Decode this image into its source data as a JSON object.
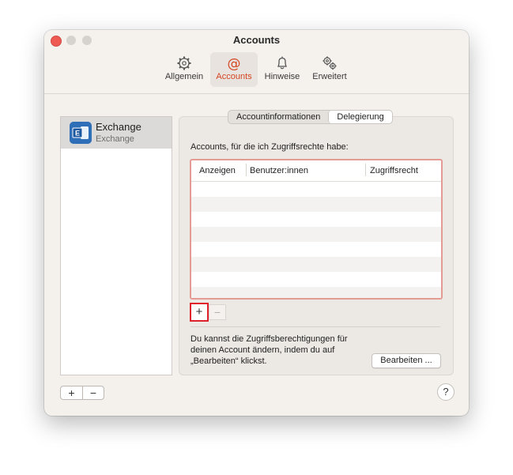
{
  "window": {
    "title": "Accounts"
  },
  "toolbar": {
    "tabs": [
      {
        "label": "Allgemein",
        "icon": "gear-icon"
      },
      {
        "label": "Accounts",
        "icon": "at-sign-icon",
        "selected": true
      },
      {
        "label": "Hinweise",
        "icon": "bell-icon"
      },
      {
        "label": "Erweitert",
        "icon": "gears-icon"
      }
    ]
  },
  "sidebar": {
    "accounts": [
      {
        "name": "Exchange",
        "type": "Exchange",
        "icon": "exchange-icon"
      }
    ],
    "add_label": "+",
    "remove_label": "−"
  },
  "segments": {
    "info": "Accountinformationen",
    "delegation": "Delegierung",
    "selected": "Delegierung"
  },
  "delegation": {
    "caption": "Accounts, für die ich Zugriffsrechte habe:",
    "columns": [
      "Anzeigen",
      "Benutzer:innen",
      "Zugriffsrecht"
    ],
    "rows": [],
    "add_label": "+",
    "remove_label": "−",
    "note": "Du kannst die Zugriffsberechtigungen für deinen Account ändern, indem du auf „Bearbeiten“ klickst.",
    "edit_label": "Bearbeiten ..."
  },
  "help_label": "?",
  "colors": {
    "accent": "#d44523",
    "highlight_border": "#e0202a"
  }
}
